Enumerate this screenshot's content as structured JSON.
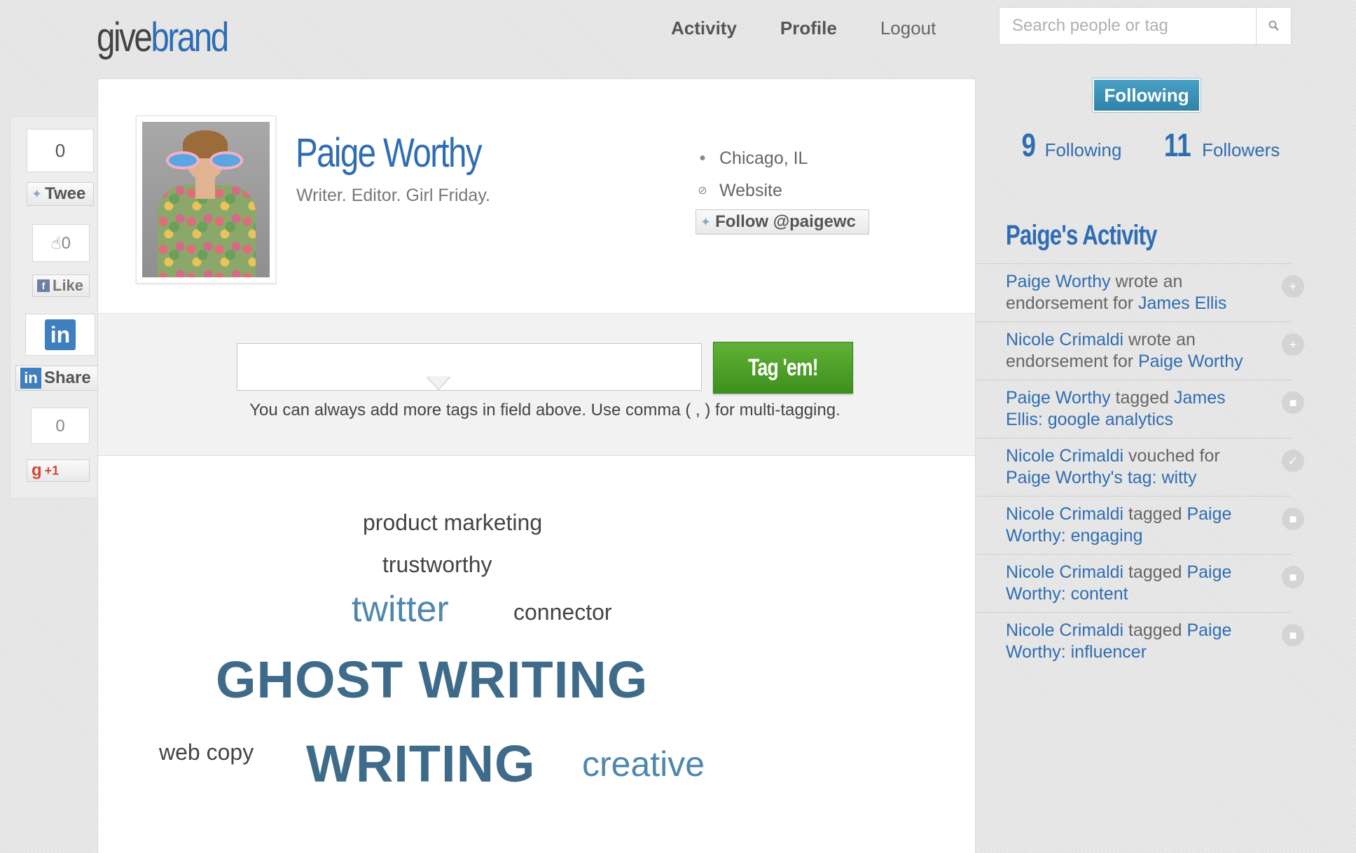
{
  "header": {
    "logo_part1": "give",
    "logo_part2": "brand",
    "nav": [
      {
        "label": "Activity"
      },
      {
        "label": "Profile"
      },
      {
        "label": "Logout"
      }
    ],
    "search_placeholder": "Search people or tag",
    "search_icon": "search-icon"
  },
  "profile": {
    "name": "Paige Worthy",
    "bio": "Writer. Editor. Girl Friday.",
    "location": "Chicago, IL",
    "website_label": "Website",
    "follow_button": "Follow @paigewc"
  },
  "tagging": {
    "button_label": "Tag 'em!",
    "input_value": "",
    "hint": "You can always add more tags in field above. Use comma ( , ) for multi-tagging."
  },
  "tag_cloud": [
    {
      "text": "product marketing"
    },
    {
      "text": "trustworthy"
    },
    {
      "text": "twitter"
    },
    {
      "text": "connector"
    },
    {
      "text": "GHOST WRITING"
    },
    {
      "text": "web copy"
    },
    {
      "text": "WRITING"
    },
    {
      "text": "creative"
    }
  ],
  "share": {
    "tweet_count": "0",
    "tweet_label": "Twee",
    "like_count": "0",
    "like_label": "Like",
    "linkedin_label": "Share",
    "gplus_count": "0",
    "gplus_label": "+1"
  },
  "sidebar": {
    "following_badge": "Following",
    "following_count": "9",
    "following_label": "Following",
    "followers_count": "11",
    "followers_label": "Followers",
    "activity_title": "Paige's Activity",
    "activity": [
      {
        "actor": "Paige Worthy",
        "verb": " wrote an endorsement for ",
        "target": "James Ellis",
        "tail": "",
        "icon": "plus-icon"
      },
      {
        "actor": "Nicole Crimaldi",
        "verb": " wrote an endorsement for ",
        "target": "Paige Worthy",
        "tail": "",
        "icon": "plus-icon"
      },
      {
        "actor": "Paige Worthy",
        "verb": " tagged ",
        "target": "James Ellis",
        "tail": ": google analytics",
        "icon": "tag-icon"
      },
      {
        "actor": "Nicole Crimaldi",
        "verb": " vouched for ",
        "target": "Paige Worthy",
        "tail": "'s tag: witty",
        "icon": "check-icon"
      },
      {
        "actor": "Nicole Crimaldi",
        "verb": " tagged ",
        "target": "Paige Worthy",
        "tail": ": engaging",
        "icon": "tag-icon"
      },
      {
        "actor": "Nicole Crimaldi",
        "verb": " tagged ",
        "target": "Paige Worthy",
        "tail": ": content",
        "icon": "tag-icon"
      },
      {
        "actor": "Nicole Crimaldi",
        "verb": " tagged ",
        "target": "Paige Worthy",
        "tail": ": influencer",
        "icon": "tag-icon"
      }
    ]
  },
  "colors": {
    "brand_blue": "#2f6db3",
    "tag_button_green": "#4fa12a",
    "following_badge": "#3b91b6",
    "cloud_dark": "#3f6b8a"
  }
}
